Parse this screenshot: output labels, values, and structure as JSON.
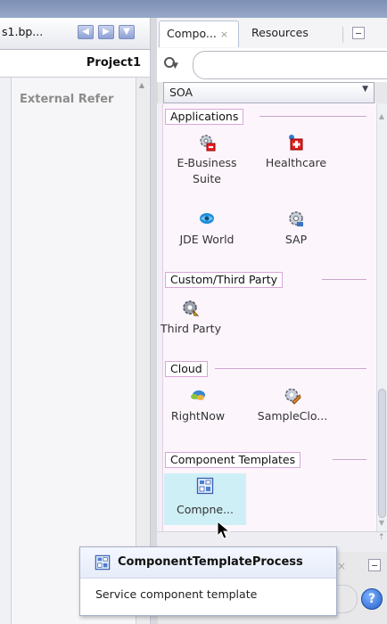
{
  "left_pane": {
    "tab_label": "s1.bp...",
    "project_label": "Project1",
    "section_label": "External Refer"
  },
  "right_pane": {
    "tabs": [
      {
        "label": "Compo...",
        "active": true
      },
      {
        "label": "Resources",
        "active": false
      }
    ],
    "tab_close_glyph": "×",
    "category_select": "SOA",
    "sections": [
      {
        "label": "Applications",
        "items": [
          {
            "label": "E-Business Suite",
            "icon": "gear-red-icon"
          },
          {
            "label": "Healthcare",
            "icon": "healthcare-icon"
          },
          {
            "label": "JDE World",
            "icon": "jde-world-icon"
          },
          {
            "label": "SAP",
            "icon": "sap-gear-icon"
          }
        ]
      },
      {
        "label": "Custom/Third Party",
        "items": [
          {
            "label": "Third Party",
            "icon": "third-party-icon"
          }
        ]
      },
      {
        "label": "Cloud",
        "items": [
          {
            "label": "RightNow",
            "icon": "rightnow-icon"
          },
          {
            "label": "SampleClo...",
            "icon": "sample-cloud-icon"
          }
        ]
      },
      {
        "label": "Component Templates",
        "items": [
          {
            "label": "Compne...",
            "icon": "component-template-icon",
            "highlighted": true
          }
        ]
      }
    ]
  },
  "tooltip": {
    "title": "ComponentTemplateProcess",
    "description": "Service component template"
  },
  "help_label": "?",
  "colors": {
    "palette_bg": "#fdf5fc",
    "section_border": "#d8a6d9",
    "highlight": "#cfeff6",
    "top_strip": "#7d8fb4"
  }
}
